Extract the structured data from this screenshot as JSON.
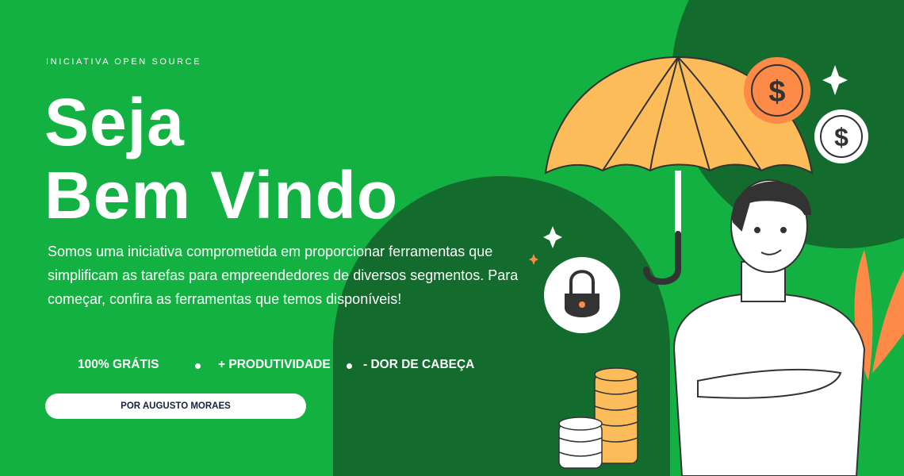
{
  "eyebrow": "INICIATIVA OPEN SOURCE",
  "title_line1": "Seja",
  "title_line2": "Bem Vindo",
  "description": "Somos uma iniciativa comprometida em proporcionar ferramentas que simplificam as tarefas para empreendedores de diversos segmentos. Para começar, confira as ferramentas que temos disponíveis!",
  "features": [
    "100% GRÁTIS",
    "+ PRODUTIVIDADE",
    "- DOR DE CABEÇA"
  ],
  "author_button": "POR AUGUSTO MORAES",
  "colors": {
    "background": "#12b141",
    "dark_green": "#136b2e",
    "umbrella": "#fdbc5a",
    "coin_orange": "#fe8a47",
    "coin_gold": "#fdbc5a"
  },
  "icons": [
    "umbrella-icon",
    "dollar-coin-icon",
    "sparkle-icon",
    "lock-icon",
    "coin-stack-icon",
    "person-illustration",
    "leaf-icon"
  ]
}
